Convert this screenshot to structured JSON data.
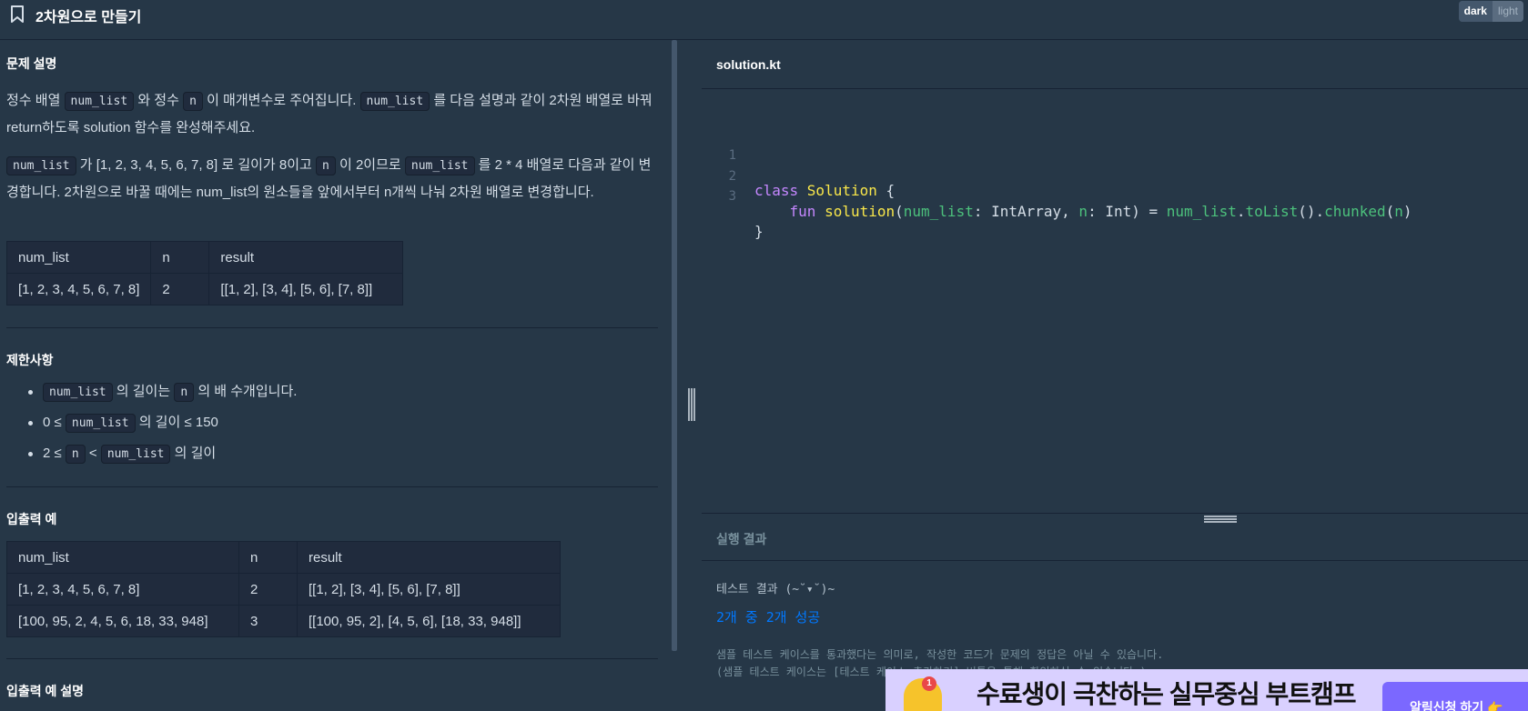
{
  "header": {
    "title": "2차원으로 만들기",
    "theme_dark": "dark",
    "theme_light": "light"
  },
  "problem": {
    "desc_title": "문제 설명",
    "p1": {
      "t1": "정수 배열 ",
      "c1": "num_list",
      "t2": " 와 정수 ",
      "c2": "n",
      "t3": " 이 매개변수로 주어집니다. ",
      "c3": "num_list",
      "t4": " 를 다음 설명과 같이 2차원 배열로 바꿔 return하도록 solution 함수를 완성해주세요."
    },
    "p2": {
      "c1": "num_list",
      "t1": " 가 [1, 2, 3, 4, 5, 6, 7, 8] 로 길이가 8이고 ",
      "c2": "n",
      "t2": " 이 2이므로 ",
      "c3": "num_list",
      "t3": " 를 2 * 4 배열로 다음과 같이 변경합니다. 2차원으로 바꿀 때에는 num_list의 원소들을 앞에서부터 n개씩 나눠 2차원 배열로 변경합니다."
    },
    "example_table": {
      "headers": [
        "num_list",
        "n",
        "result"
      ],
      "rows": [
        [
          "[1, 2, 3, 4, 5, 6, 7, 8]",
          "2",
          "[[1, 2], [3, 4], [5, 6], [7, 8]]"
        ]
      ]
    },
    "constraints_title": "제한사항",
    "constraints": [
      {
        "c1": "num_list",
        "t1": " 의 길이는 ",
        "c2": "n",
        "t2": " 의 배 수개입니다."
      },
      {
        "t0": "0 ≤ ",
        "c1": "num_list",
        "t1": " 의 길이 ≤ 150"
      },
      {
        "t0": "2 ≤ ",
        "c1": "n",
        "t1": " < ",
        "c2": "num_list",
        "t2": " 의 길이"
      }
    ],
    "io_title": "입출력 예",
    "io_table": {
      "headers": [
        "num_list",
        "n",
        "result"
      ],
      "rows": [
        [
          "[1, 2, 3, 4, 5, 6, 7, 8]",
          "2",
          "[[1, 2], [3, 4], [5, 6], [7, 8]]"
        ],
        [
          "[100, 95, 2, 4, 5, 6, 18, 33, 948]",
          "3",
          "[[100, 95, 2], [4, 5, 6], [18, 33, 948]]"
        ]
      ]
    },
    "io_explain_title": "입출력 예 설명"
  },
  "editor": {
    "filename": "solution.kt",
    "line_numbers": [
      "1",
      "2",
      "3"
    ],
    "lines": [
      [
        {
          "t": "class ",
          "k": "kw"
        },
        {
          "t": "Solution",
          "k": "cls"
        },
        {
          "t": " {",
          "k": "ty"
        }
      ],
      [
        {
          "t": "    fun ",
          "k": "kw"
        },
        {
          "t": "solution",
          "k": "fn"
        },
        {
          "t": "(",
          "k": "ty"
        },
        {
          "t": "num_list",
          "k": "param"
        },
        {
          "t": ": IntArray, ",
          "k": "ty"
        },
        {
          "t": "n",
          "k": "param"
        },
        {
          "t": ": Int) = ",
          "k": "ty"
        },
        {
          "t": "num_list",
          "k": "param"
        },
        {
          "t": ".",
          "k": "ty"
        },
        {
          "t": "toList",
          "k": "param"
        },
        {
          "t": "().",
          "k": "ty"
        },
        {
          "t": "chunked",
          "k": "param"
        },
        {
          "t": "(",
          "k": "ty"
        },
        {
          "t": "n",
          "k": "param"
        },
        {
          "t": ")",
          "k": "ty"
        }
      ],
      [
        {
          "t": "}",
          "k": "ty"
        }
      ]
    ]
  },
  "result": {
    "title": "실행 결과",
    "line1": "테스트 결과 (~˘▾˘)~",
    "line2": "2개 중 2개 성공",
    "note1": "샘플 테스트 케이스를 통과했다는 의미로, 작성한 코드가 문제의 정답은 아닐 수 있습니다.",
    "note2": "(샘플 테스트 케이스는 [테스트 케이스 추가하기] 버튼을 통해 확인하실 수 있습니다.)"
  },
  "banner": {
    "badge": "1",
    "text": "수료생이 극찬하는 실무중심 부트캠프",
    "button": "알림신청 하기 👉"
  },
  "colors": {
    "background": "#263747",
    "accent_blue": "#0078ff",
    "keyword": "#c587ff",
    "function": "#f9e74a",
    "identifier": "#4cc17c"
  }
}
